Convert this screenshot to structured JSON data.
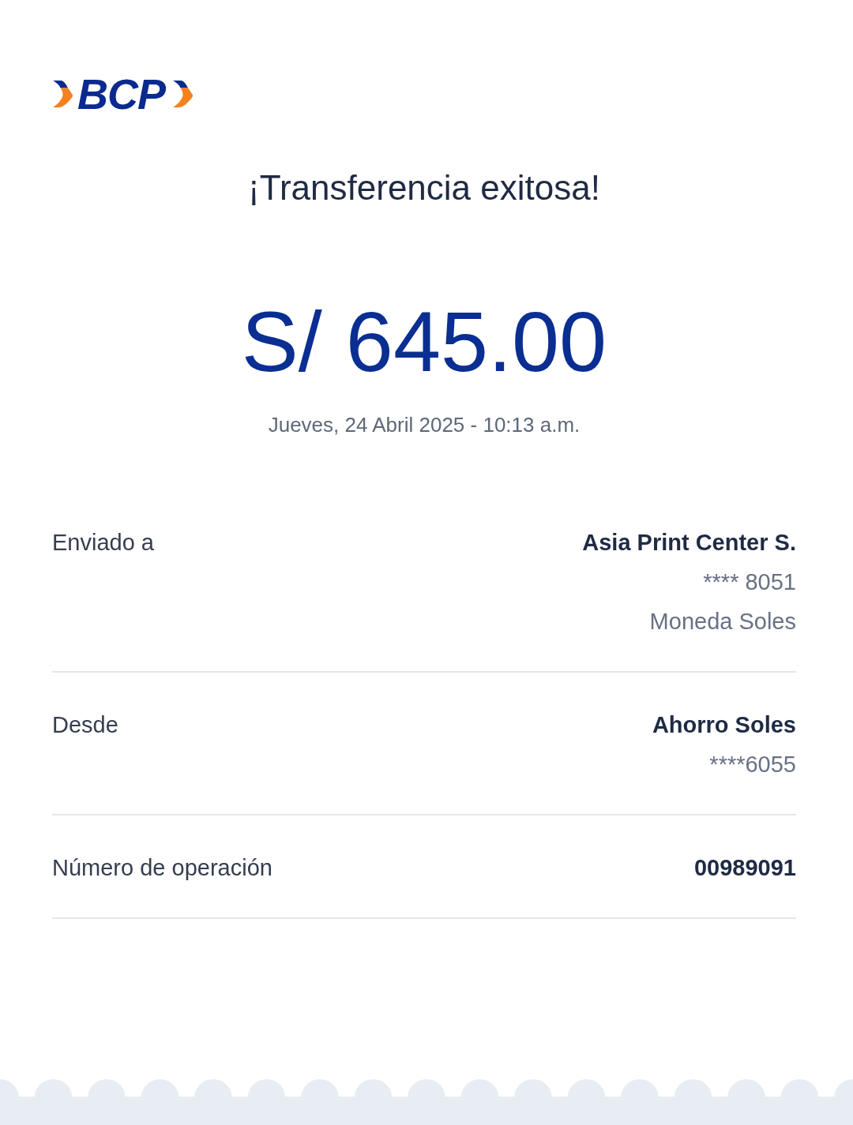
{
  "logo": {
    "text": "BCP"
  },
  "title": "¡Transferencia exitosa!",
  "amount": "S/ 645.00",
  "datetime": "Jueves, 24 Abril 2025 - 10:13 a.m.",
  "details": [
    {
      "label": "Enviado a",
      "values": [
        {
          "text": "Asia Print Center S.",
          "kind": "primary"
        },
        {
          "text": "**** 8051",
          "kind": "secondary"
        },
        {
          "text": "Moneda Soles",
          "kind": "secondary"
        }
      ]
    },
    {
      "label": "Desde",
      "values": [
        {
          "text": "Ahorro Soles",
          "kind": "primary"
        },
        {
          "text": "****6055",
          "kind": "secondary"
        }
      ]
    },
    {
      "label": "Número de operación",
      "values": [
        {
          "text": "00989091",
          "kind": "primary"
        }
      ]
    }
  ]
}
